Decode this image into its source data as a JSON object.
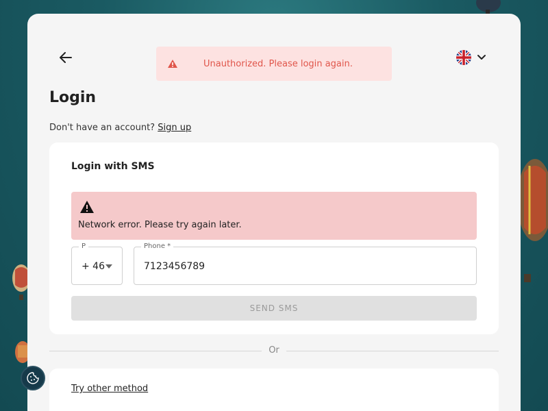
{
  "header": {
    "back_icon": "arrow-left-icon",
    "language_icon": "uk-flag-icon",
    "language_chevron_icon": "chevron-down-icon"
  },
  "toast": {
    "icon": "warning-icon",
    "message": "Unauthorized. Please login again.",
    "color": "#e0554a",
    "background": "#fde2e1"
  },
  "page": {
    "title": "Login",
    "signup_prompt": "Don't have an account?",
    "signup_link": "Sign up"
  },
  "sms_card": {
    "title": "Login with SMS",
    "error": {
      "icon": "warning-icon",
      "message": "Network error. Please try again later."
    },
    "prefix": {
      "legend": "P",
      "value": "+ 46"
    },
    "phone": {
      "legend": "Phone *",
      "value": "7123456789"
    },
    "send_button": "SEND SMS"
  },
  "divider": {
    "label": "Or"
  },
  "other": {
    "link": "Try other method"
  },
  "cookie": {
    "icon": "cookie-icon"
  }
}
